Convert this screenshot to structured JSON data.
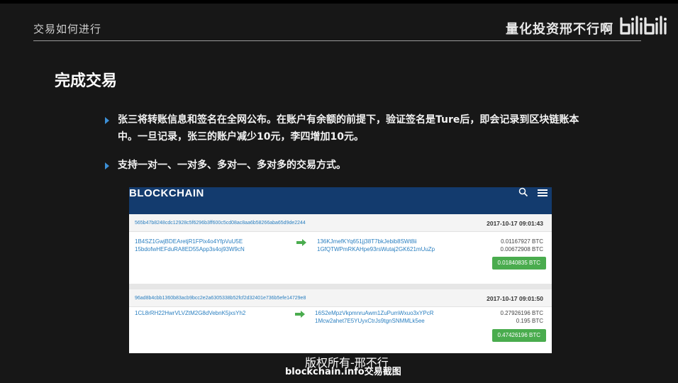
{
  "header": {
    "section_title": "交易如何进行",
    "channel_name": "量化投资邢不行啊"
  },
  "slide": {
    "title": "完成交易",
    "bullets": [
      "张三将转账信息和签名在全网公布。在账户有余额的前提下，验证签名是Ture后，即会记录到区块链账本中。一旦记录，张三的账户减少10元，李四增加10元。",
      "支持一对一、一对多、多对一、多对多的交易方式。"
    ]
  },
  "blockchain": {
    "logo": "BLOCKCHAIN",
    "transactions": [
      {
        "hash": "565b47b8248cdc12928c5f6296b3ff600c5cd08ac8aa6b58266aba65d9de2244",
        "time": "2017-10-17 09:01:43",
        "inputs": [
          "1B4SZ1GwjBDEAretjR1FPix4o4YfpVuU5E",
          "15bdofwHEFduRA8ED55App3s4oj93W9cN"
        ],
        "outputs": [
          "136KJmefKYq651jj38T7bkJebib8SWt8ii",
          "1GfQTWPmRKAHpe93rsWutaj2GK621mUuZp"
        ],
        "amounts": [
          "0.01167927 BTC",
          "0.00672908 BTC"
        ],
        "total": "0.01840835 BTC"
      },
      {
        "hash": "96ad8b4cbb1360b83acb9bcc2e2a6305338b52fcf2d32401e736b5efe14729e8",
        "time": "2017-10-17 09:01:50",
        "inputs": [
          "1CL8rRH22HwrVLVZtM2G8dVebnK5jxsYh2"
        ],
        "outputs": [
          "16S2eMpzVkpmnruAwm1ZuPumWxuo3xYPcR",
          "1Mcw2ahet7E5YUyxCtrJs9tgnSNMMLk5ee"
        ],
        "amounts": [
          "0.27926196 BTC",
          "0.195 BTC"
        ],
        "total": "0.47426196 BTC"
      }
    ]
  },
  "footer": {
    "watermark": "版权所有-邢不行",
    "caption": "blockchain.info交易截图"
  },
  "colors": {
    "background": "#171717",
    "accent_blue": "#3c8fd6",
    "blockchain_nav": "#133b6e",
    "link_blue": "#2a7fc0",
    "btc_green": "#4aac4e"
  }
}
